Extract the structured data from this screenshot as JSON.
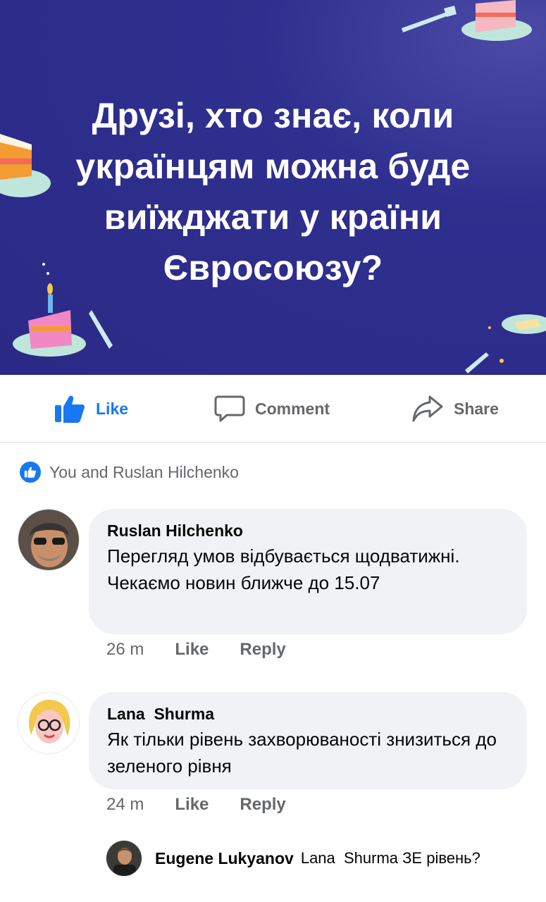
{
  "post": {
    "banner_text": "Друзі, хто знає, коли українцям можна буде виїжджати у країни Євросоюзу?",
    "banner_color": "#2b2a86"
  },
  "actions": {
    "like_label": "Like",
    "comment_label": "Comment",
    "share_label": "Share"
  },
  "reactions": {
    "text": "You and Ruslan Hilchenko"
  },
  "comments": [
    {
      "author": "Ruslan Hilchenko",
      "text": "Перегляд умов відбувається щодватижні. Чекаємо новин ближче до 15.07",
      "time": "26 m",
      "like_label": "Like",
      "reply_label": "Reply"
    },
    {
      "author": "Lana  Shurma",
      "text": "Як тільки рівень захворюваності знизиться до зеленого рівня",
      "time": "24 m",
      "like_label": "Like",
      "reply_label": "Reply"
    }
  ],
  "reply": {
    "author": "Eugene Lukyanov",
    "text": "Lana  Shurma ЗЕ рівень?"
  },
  "colors": {
    "accent": "#1877f2",
    "muted": "#65676b",
    "bubble": "#f0f2f5"
  }
}
